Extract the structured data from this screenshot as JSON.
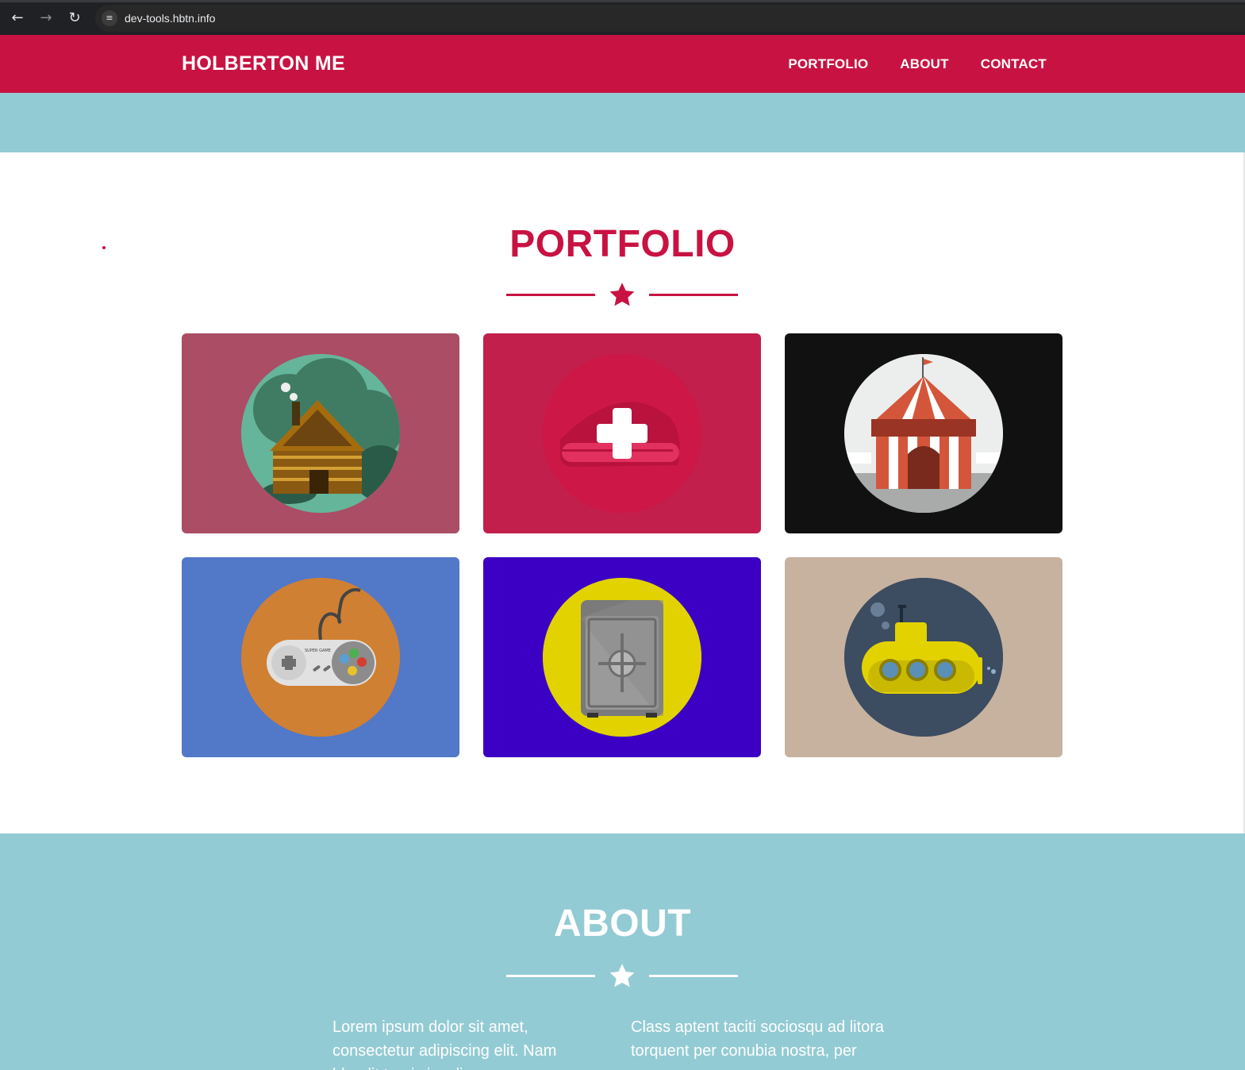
{
  "browser": {
    "url": "dev-tools.hbtn.info",
    "back_icon": "arrow-left-icon",
    "forward_icon": "arrow-right-icon",
    "reload_icon": "reload-icon",
    "site_info_icon": "tune-icon"
  },
  "header": {
    "brand": "HOLBERTON ME",
    "nav": [
      "PORTFOLIO",
      "ABOUT",
      "CONTACT"
    ],
    "color": "#c81342"
  },
  "hero": {
    "color": "#93cbd4"
  },
  "portfolio": {
    "title": "PORTFOLIO",
    "divider_icon": "star-icon",
    "tiles": [
      {
        "icon": "cabin-icon",
        "background": "#ab4d65",
        "circle": "#65b59a"
      },
      {
        "icon": "cake-icon",
        "background": "#c21f4c",
        "circle": "#cd1746"
      },
      {
        "icon": "circus-tent-icon",
        "background": "#111111",
        "circle": "#eceeee"
      },
      {
        "icon": "game-controller-icon",
        "background": "#5278c8",
        "circle": "#d08032"
      },
      {
        "icon": "safe-icon",
        "background": "#3b00c4",
        "circle": "#e2d200"
      },
      {
        "icon": "submarine-icon",
        "background": "#c7b29f",
        "circle": "#3c4c61"
      }
    ],
    "controller_text": "SUPER GAME"
  },
  "about": {
    "title": "ABOUT",
    "divider_icon": "star-icon",
    "col1": "Lorem ipsum dolor sit amet, consectetur adipiscing elit. Nam blandit turpis iaculis",
    "col2": "Class aptent taciti sociosqu ad litora torquent per conubia nostra, per"
  }
}
